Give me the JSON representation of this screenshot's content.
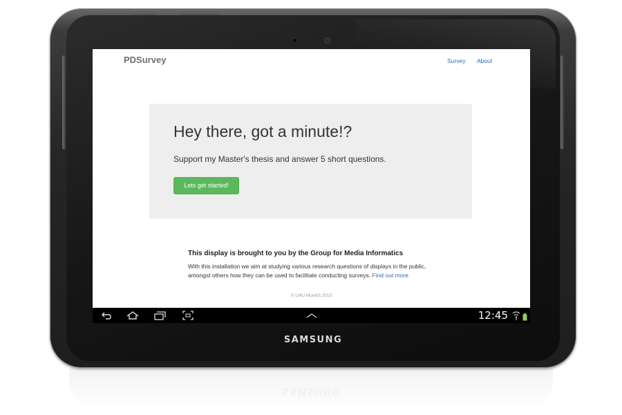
{
  "device": {
    "brand": "SAMSUNG"
  },
  "app": {
    "title": "PDSurvey",
    "nav": [
      {
        "label": "Survey"
      },
      {
        "label": "About"
      }
    ]
  },
  "hero": {
    "title": "Hey there, got a minute!?",
    "lead": "Support my Master's thesis and answer 5 short questions.",
    "button_label": "Lets get started!",
    "button_color": "#5cb85c"
  },
  "info": {
    "heading": "This display is brought to you by the Group for Media Informatics",
    "body": "With this installation we aim at studying various research questions of displays in the public, amongst others how they can be used to facilitate conducting surveys.",
    "link_label": "Find out more"
  },
  "footer": {
    "copyright": "© LMU Munich 2015"
  },
  "system_bar": {
    "time": "12:45",
    "icons": [
      "back-icon",
      "home-icon",
      "recent-apps-icon",
      "screenshot-icon",
      "chevron-up-icon",
      "wifi-icon",
      "battery-icon"
    ]
  }
}
